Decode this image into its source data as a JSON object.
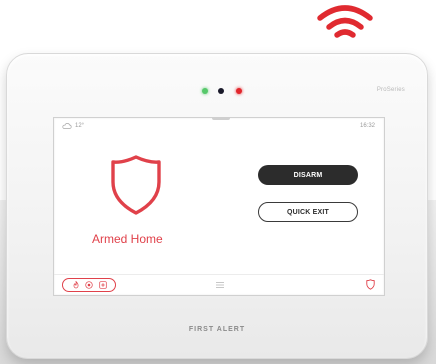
{
  "status": {
    "temperature": "12°",
    "time": "16:32",
    "weather_icon": "cloud-icon"
  },
  "alarm": {
    "state_label": "Armed Home",
    "state_icon": "shield-icon"
  },
  "actions": {
    "disarm_label": "DISARM",
    "quick_exit_label": "QUICK EXIT"
  },
  "bottom_bar": {
    "quick_icons": [
      "fire-icon",
      "police-icon",
      "medical-icon"
    ],
    "menu_icon": "menu-icon",
    "security_icon": "shield-icon"
  },
  "device": {
    "series_label": "ProSeries",
    "brand_label": "FIRST ALERT",
    "indicator_leds": [
      "green",
      "black",
      "red"
    ]
  },
  "colors": {
    "accent_red": "#e0414a",
    "button_dark": "#2c2c2c"
  }
}
